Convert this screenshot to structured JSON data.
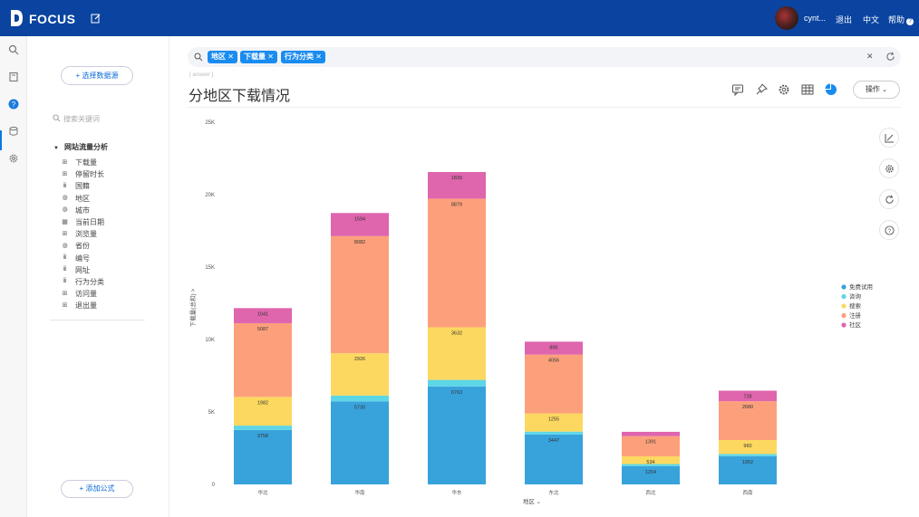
{
  "topbar": {
    "brand": "FOCUS",
    "user": "cynt...",
    "logout": "退出",
    "language": "中文",
    "help": "帮助",
    "help_badge": "?"
  },
  "left": {
    "select_source": "+ 选择数据源",
    "search_placeholder": "搜索关键词",
    "tree_title": "网站流量分析",
    "fields": [
      {
        "label": "下载量",
        "icon": "measure-icon"
      },
      {
        "label": "停留时长",
        "icon": "measure-icon"
      },
      {
        "label": "国籍",
        "icon": "dimension-icon"
      },
      {
        "label": "地区",
        "icon": "globe-icon"
      },
      {
        "label": "城市",
        "icon": "globe-icon"
      },
      {
        "label": "当前日期",
        "icon": "calendar-icon"
      },
      {
        "label": "浏览量",
        "icon": "measure-icon"
      },
      {
        "label": "省份",
        "icon": "globe-icon"
      },
      {
        "label": "编号",
        "icon": "dimension-icon"
      },
      {
        "label": "网址",
        "icon": "dimension-icon"
      },
      {
        "label": "行为分类",
        "icon": "dimension-icon"
      },
      {
        "label": "访问量",
        "icon": "measure-icon"
      },
      {
        "label": "退出量",
        "icon": "measure-icon"
      }
    ],
    "add_formula": "+ 添加公式"
  },
  "search": {
    "tags": [
      "地区",
      "下载量",
      "行为分类"
    ]
  },
  "main": {
    "version_text": "[ answer ]",
    "title": "分地区下载情况",
    "operate_label": "操作"
  },
  "colors": {
    "topbar": "#0a44a0",
    "accent": "#1a8cf0"
  },
  "chart_data": {
    "type": "bar",
    "stacked": true,
    "categories": [
      "华北",
      "华南",
      "华东",
      "东北",
      "西北",
      "西南"
    ],
    "series": [
      {
        "name": "免费试用",
        "color": "#38a2db",
        "values": [
          3758,
          5730,
          6763,
          3447,
          1254,
          1952
        ]
      },
      {
        "name": "咨询",
        "color": "#5dd6e6",
        "values": [
          300,
          400,
          450,
          200,
          150,
          150
        ]
      },
      {
        "name": "搜索",
        "color": "#fdd860",
        "values": [
          1982,
          2926,
          3632,
          1255,
          534,
          960
        ]
      },
      {
        "name": "注册",
        "color": "#fca07c",
        "values": [
          5087,
          8082,
          8879,
          4056,
          1391,
          2680
        ]
      },
      {
        "name": "社区",
        "color": "#df65ad",
        "values": [
          1041,
          1594,
          1839,
          895,
          300,
          728
        ]
      }
    ],
    "value_labels": [
      [
        "3758",
        "",
        "1982",
        "5087",
        "1041"
      ],
      [
        "5730",
        "",
        "2926",
        "8082",
        "1594"
      ],
      [
        "6763",
        "",
        "3632",
        "8879",
        "1839"
      ],
      [
        "3447",
        "",
        "1255",
        "4056",
        "895"
      ],
      [
        "1254",
        "",
        "534",
        "1391",
        ""
      ],
      [
        "1952",
        "",
        "960",
        "2680",
        "728"
      ]
    ],
    "xlabel": "地区",
    "ylabel": "下载量(总和)",
    "ylim": [
      0,
      25000
    ],
    "yticks": [
      0,
      5000,
      10000,
      15000,
      20000,
      25000
    ],
    "ytick_labels": [
      "0",
      "5K",
      "10K",
      "15K",
      "20K",
      "25K"
    ],
    "legend_position": "right",
    "grid": false
  }
}
